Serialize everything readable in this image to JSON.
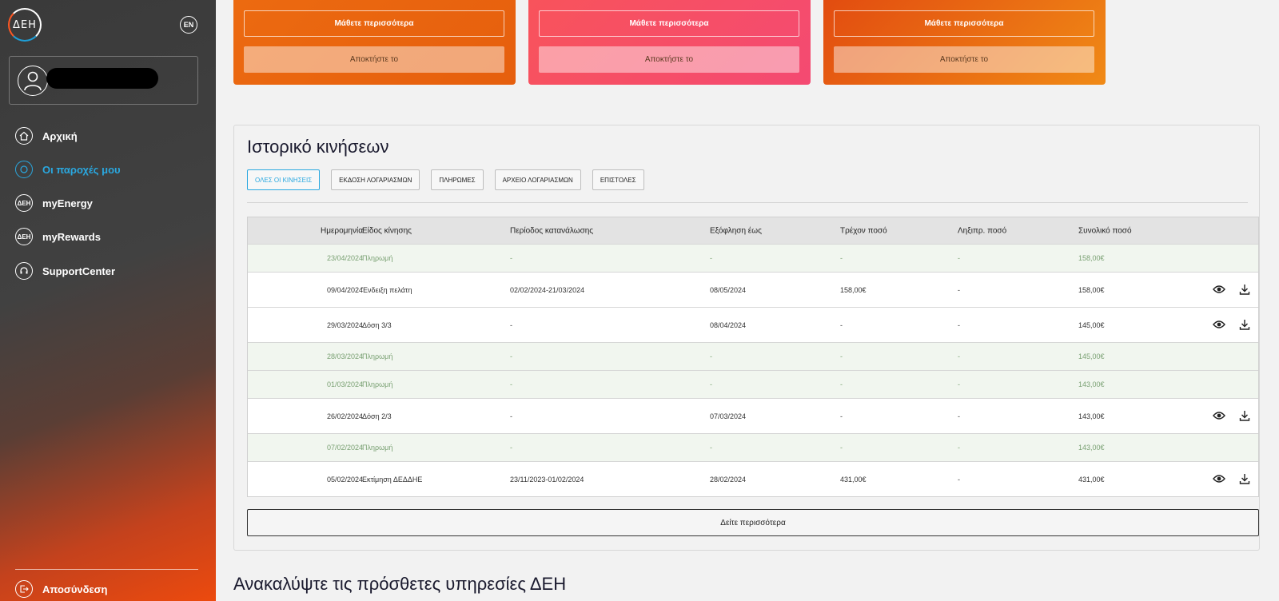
{
  "sidebar": {
    "logo": "ΔΕΗ",
    "lang": "EN",
    "nav": [
      {
        "label": "Αρχική",
        "icon": "home-icon"
      },
      {
        "label": "Οι παροχές μου",
        "icon": "meter-icon"
      },
      {
        "label": "myEnergy",
        "icon": "deh-icon"
      },
      {
        "label": "myRewards",
        "icon": "deh-icon"
      },
      {
        "label": "SupportCenter",
        "icon": "support-icon"
      }
    ],
    "logout": "Αποσύνδεση"
  },
  "promos": [
    {
      "learn": "Μάθετε περισσότερα",
      "get": "Αποκτήστε το"
    },
    {
      "learn": "Μάθετε περισσότερα",
      "get": "Αποκτήστε το"
    },
    {
      "learn": "Μάθετε περισσότερα",
      "get": "Αποκτήστε το"
    }
  ],
  "history": {
    "title": "Ιστορικό κινήσεων",
    "filters": [
      "ΟΛΕΣ ΟΙ ΚΙΝΗΣΕΙΣ",
      "ΕΚΔΟΣΗ ΛΟΓΑΡΙΑΣΜΩΝ",
      "ΠΛΗΡΩΜΕΣ",
      "ΑΡΧΕΙΟ ΛΟΓΑΡΙΑΣΜΩΝ",
      "ΕΠΙΣΤΟΛΕΣ"
    ],
    "headers": [
      "Ημερομηνία",
      "Είδος κίνησης",
      "Περίοδος κατανάλωσης",
      "Εξόφληση έως",
      "Τρέχον ποσό",
      "Ληξιπρ. ποσό",
      "Συνολικό ποσό"
    ],
    "rows": [
      {
        "kind": "pay",
        "date": "23/04/2024",
        "type": "Πληρωμή",
        "period": "-",
        "due": "-",
        "current": "-",
        "overdue": "-",
        "total": "158,00€"
      },
      {
        "kind": "bill",
        "date": "09/04/2024",
        "type": "Ένδειξη πελάτη",
        "period": "02/02/2024-21/03/2024",
        "due": "08/05/2024",
        "current": "158,00€",
        "overdue": "-",
        "total": "158,00€"
      },
      {
        "kind": "bill",
        "date": "29/03/2024",
        "type": "Δόση 3/3",
        "period": "-",
        "due": "08/04/2024",
        "current": "-",
        "overdue": "-",
        "total": "145,00€"
      },
      {
        "kind": "pay",
        "date": "28/03/2024",
        "type": "Πληρωμή",
        "period": "-",
        "due": "-",
        "current": "-",
        "overdue": "-",
        "total": "145,00€"
      },
      {
        "kind": "pay",
        "date": "01/03/2024",
        "type": "Πληρωμή",
        "period": "-",
        "due": "-",
        "current": "-",
        "overdue": "-",
        "total": "143,00€"
      },
      {
        "kind": "bill",
        "date": "26/02/2024",
        "type": "Δόση 2/3",
        "period": "-",
        "due": "07/03/2024",
        "current": "-",
        "overdue": "-",
        "total": "143,00€"
      },
      {
        "kind": "pay",
        "date": "07/02/2024",
        "type": "Πληρωμή",
        "period": "-",
        "due": "-",
        "current": "-",
        "overdue": "-",
        "total": "143,00€"
      },
      {
        "kind": "bill",
        "date": "05/02/2024",
        "type": "Εκτίμηση ΔΕΔΔΗΕ",
        "period": "23/11/2023-01/02/2024",
        "due": "28/02/2024",
        "current": "431,00€",
        "overdue": "-",
        "total": "431,00€"
      }
    ],
    "more": "Δείτε περισσότερα"
  },
  "services_title": "Ανακαλύψτε τις πρόσθετες υπηρεσίες ΔΕΗ"
}
